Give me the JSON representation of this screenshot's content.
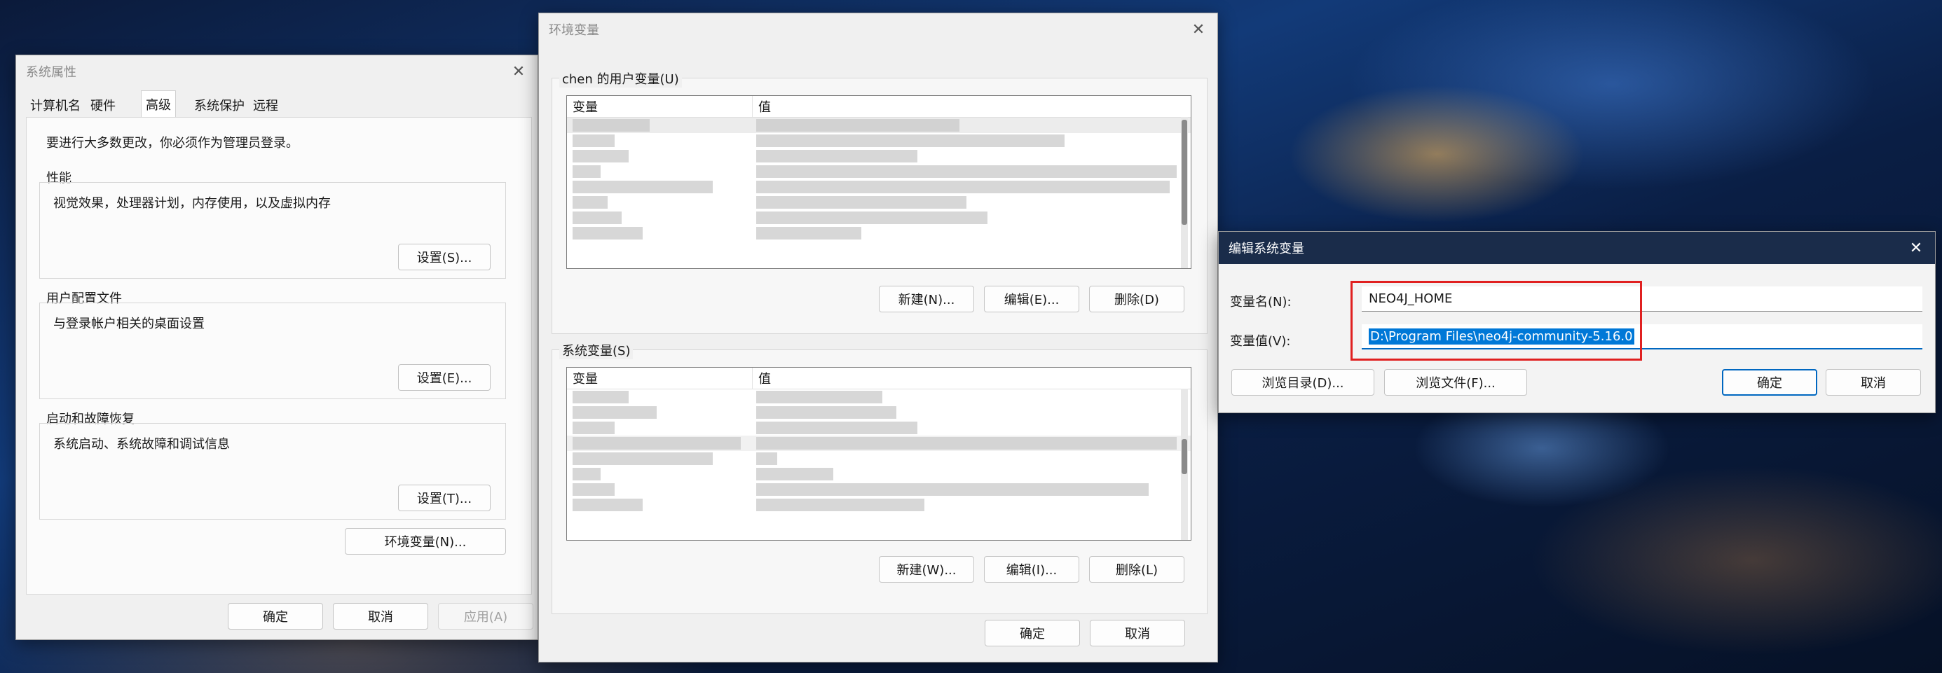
{
  "sys_props": {
    "title": "系统属性",
    "tabs": [
      "计算机名",
      "硬件",
      "高级",
      "系统保护",
      "远程"
    ],
    "admin_note": "要进行大多数更改，你必须作为管理员登录。",
    "perf": {
      "label": "性能",
      "desc": "视觉效果，处理器计划，内存使用，以及虚拟内存",
      "button": "设置(S)..."
    },
    "profile": {
      "label": "用户配置文件",
      "desc": "与登录帐户相关的桌面设置",
      "button": "设置(E)..."
    },
    "startup": {
      "label": "启动和故障恢复",
      "desc": "系统启动、系统故障和调试信息",
      "button": "设置(T)..."
    },
    "env_button": "环境变量(N)...",
    "ok": "确定",
    "cancel": "取消",
    "apply": "应用(A)"
  },
  "env_vars": {
    "title": "环境变量",
    "user_group": "chen 的用户变量(U)",
    "sys_group": "系统变量(S)",
    "col_var": "变量",
    "col_val": "值",
    "user_new": "新建(N)...",
    "user_edit": "编辑(E)...",
    "user_delete": "删除(D)",
    "sys_new": "新建(W)...",
    "sys_edit": "编辑(I)...",
    "sys_delete": "删除(L)",
    "ok": "确定",
    "cancel": "取消"
  },
  "edit_var": {
    "title": "编辑系统变量",
    "name_label": "变量名(N):",
    "value_label": "变量值(V):",
    "name_value": "NEO4J_HOME",
    "value_value": "D:\\Program Files\\neo4j-community-5.16.0",
    "browse_dir": "浏览目录(D)...",
    "browse_file": "浏览文件(F)...",
    "ok": "确定",
    "cancel": "取消",
    "highlight_color": "#e02020",
    "selection_color": "#0078d7"
  }
}
